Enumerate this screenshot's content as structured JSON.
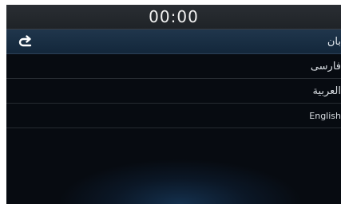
{
  "status_bar": {
    "clock": "00:00"
  },
  "language_menu": {
    "header": {
      "title": "بان",
      "back_icon": "back-arrow-icon"
    },
    "items": [
      {
        "label": "فارسی"
      },
      {
        "label": "العربية"
      },
      {
        "label": "English"
      }
    ]
  },
  "colors": {
    "background": "#070b11",
    "header_highlight": "#1a3047",
    "text": "#d8dde2",
    "divider": "#262b31"
  }
}
